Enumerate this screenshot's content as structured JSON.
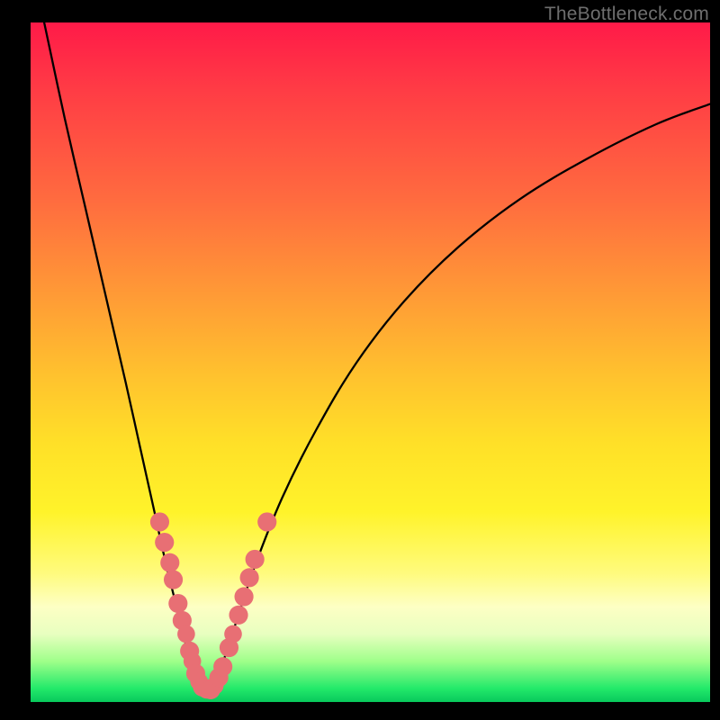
{
  "watermark": "TheBottleneck.com",
  "colors": {
    "frame": "#000000",
    "curve": "#000000",
    "marker": "#e86f74",
    "gradient_top": "#ff1a48",
    "gradient_bottom": "#08c95c"
  },
  "chart_data": {
    "type": "line",
    "title": "",
    "xlabel": "",
    "ylabel": "",
    "xlim": [
      0,
      100
    ],
    "ylim": [
      0,
      100
    ],
    "note": "No axis ticks or numeric labels are rendered; values below are estimated in percent of plot area (0 = left/bottom, 100 = right/top).",
    "series": [
      {
        "name": "bottleneck-curve",
        "x": [
          2,
          5,
          8,
          11,
          14,
          16,
          18,
          20,
          22,
          23.5,
          25,
          26.5,
          28,
          30,
          33,
          37,
          42,
          48,
          55,
          63,
          72,
          82,
          92,
          100
        ],
        "y": [
          100,
          86,
          73,
          60,
          47,
          38,
          29,
          20,
          12,
          6,
          2,
          2,
          5,
          11,
          20,
          30,
          40,
          50,
          59,
          67,
          74,
          80,
          85,
          88
        ]
      }
    ],
    "markers": {
      "name": "highlighted-points",
      "note": "Salmon circular markers clustered near the curve minimum; coordinates estimated in percent of plot area.",
      "points": [
        {
          "x": 19.0,
          "y": 26.5,
          "r": 1.4
        },
        {
          "x": 19.7,
          "y": 23.5,
          "r": 1.4
        },
        {
          "x": 20.5,
          "y": 20.5,
          "r": 1.4
        },
        {
          "x": 21.0,
          "y": 18.0,
          "r": 1.4
        },
        {
          "x": 21.7,
          "y": 14.5,
          "r": 1.4
        },
        {
          "x": 22.3,
          "y": 12.0,
          "r": 1.4
        },
        {
          "x": 22.9,
          "y": 10.0,
          "r": 1.3
        },
        {
          "x": 23.4,
          "y": 7.5,
          "r": 1.4
        },
        {
          "x": 23.8,
          "y": 6.0,
          "r": 1.3
        },
        {
          "x": 24.3,
          "y": 4.2,
          "r": 1.4
        },
        {
          "x": 24.8,
          "y": 3.0,
          "r": 1.3
        },
        {
          "x": 25.3,
          "y": 2.2,
          "r": 1.4
        },
        {
          "x": 25.9,
          "y": 1.8,
          "r": 1.3
        },
        {
          "x": 26.5,
          "y": 1.8,
          "r": 1.4
        },
        {
          "x": 27.1,
          "y": 2.4,
          "r": 1.3
        },
        {
          "x": 27.7,
          "y": 3.6,
          "r": 1.4
        },
        {
          "x": 28.3,
          "y": 5.2,
          "r": 1.4
        },
        {
          "x": 29.2,
          "y": 8.0,
          "r": 1.4
        },
        {
          "x": 29.8,
          "y": 10.0,
          "r": 1.3
        },
        {
          "x": 30.6,
          "y": 12.8,
          "r": 1.4
        },
        {
          "x": 31.4,
          "y": 15.5,
          "r": 1.4
        },
        {
          "x": 32.2,
          "y": 18.3,
          "r": 1.4
        },
        {
          "x": 33.0,
          "y": 21.0,
          "r": 1.4
        },
        {
          "x": 34.8,
          "y": 26.5,
          "r": 1.4
        }
      ]
    }
  }
}
